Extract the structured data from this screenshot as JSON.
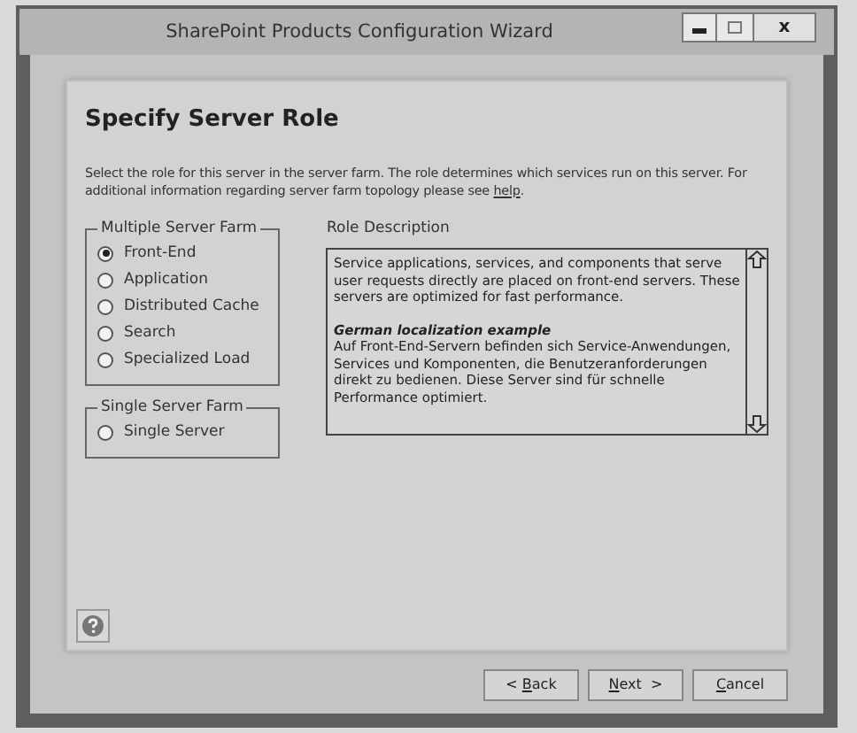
{
  "window": {
    "title": "SharePoint Products Configuration Wizard",
    "controls": [
      {
        "kind": "minimize"
      },
      {
        "kind": "maximize"
      },
      {
        "kind": "close",
        "label": "x"
      }
    ]
  },
  "page": {
    "heading": "Specify Server Role",
    "intro": "Select the role for this server in the server farm.  The role determines which services run on this server. For additional information regarding server farm topology please see ",
    "intro_link": "help",
    "intro_end": "."
  },
  "groups": [
    {
      "title": "Multiple Server Farm",
      "options": [
        {
          "label": "Front-End",
          "selected": true
        },
        {
          "label": "Application",
          "selected": false
        },
        {
          "label": "Distributed Cache",
          "selected": false
        },
        {
          "label": "Search",
          "selected": false
        },
        {
          "label": "Specialized Load",
          "selected": false
        }
      ]
    },
    {
      "title": "Single Server Farm",
      "options": [
        {
          "label": "Single Server",
          "selected": false
        }
      ]
    }
  ],
  "role_description": {
    "label": "Role Description",
    "blocks": [
      {
        "kind": "paragraph",
        "text": "Service applications, services, and components that serve user requests directly are placed on front-end servers.  These servers are optimized for fast performance."
      },
      {
        "kind": "heading",
        "text": "German localization example"
      },
      {
        "kind": "paragraph",
        "text": "Auf Front-End-Servern befinden sich Service-Anwendungen, Services und Komponenten, die Benutzeranforderungen direkt zu bedienen.  Diese Server sind für schnelle Performance optimiert."
      }
    ]
  },
  "buttons": [
    {
      "before": "< ",
      "key": "B",
      "after": "ack"
    },
    {
      "key": "N",
      "after": "ext  >"
    },
    {
      "key": "C",
      "after": "ancel"
    }
  ]
}
